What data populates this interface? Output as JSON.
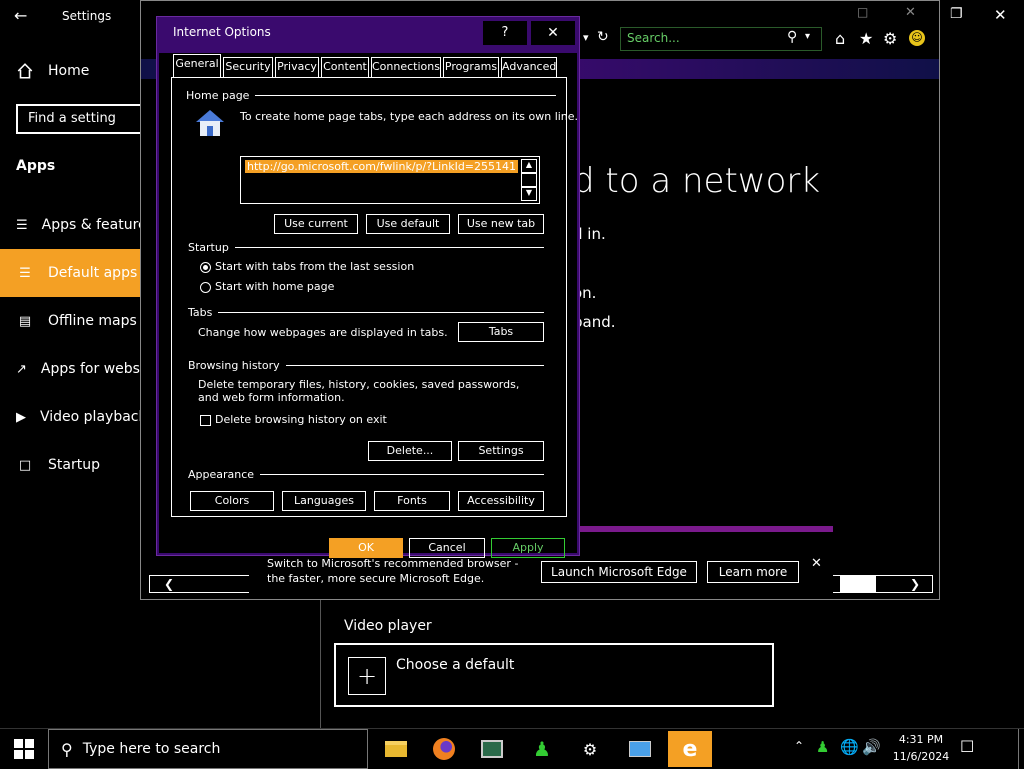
{
  "settings": {
    "title": "Settings",
    "home": "Home",
    "search_placeholder": "Find a setting",
    "section": "Apps",
    "nav": [
      "Apps & features",
      "Default apps",
      "Offline maps",
      "Apps for websites",
      "Video playback",
      "Startup"
    ],
    "video_player_title": "Video player",
    "choose_default": "Choose a default"
  },
  "browser": {
    "search_placeholder": "Search...",
    "heading_partial": "d to a network",
    "line1": "d in.",
    "line2": "on.",
    "line3": "band.",
    "notification": "Switch to Microsoft's recommended browser - the faster, more secure Microsoft Edge.",
    "launch_edge": "Launch Microsoft Edge",
    "learn_more": "Learn more"
  },
  "dialog": {
    "title": "Internet Options",
    "help": "?",
    "tabs": [
      "General",
      "Security",
      "Privacy",
      "Content",
      "Connections",
      "Programs",
      "Advanced"
    ],
    "home_page": {
      "label": "Home page",
      "hint": "To create home page tabs, type each address on its own line.",
      "url": "http://go.microsoft.com/fwlink/p/?LinkId=255141",
      "use_current": "Use current",
      "use_default": "Use default",
      "use_new_tab": "Use new tab"
    },
    "startup": {
      "label": "Startup",
      "opt1": "Start with tabs from the last session",
      "opt2": "Start with home page"
    },
    "tabs_section": {
      "label": "Tabs",
      "desc": "Change how webpages are displayed in tabs.",
      "button": "Tabs"
    },
    "history": {
      "label": "Browsing history",
      "desc": "Delete temporary files, history, cookies, saved passwords, and web form information.",
      "checkbox": "Delete browsing history on exit",
      "delete": "Delete...",
      "settings": "Settings"
    },
    "appearance": {
      "label": "Appearance",
      "colors": "Colors",
      "languages": "Languages",
      "fonts": "Fonts",
      "accessibility": "Accessibility"
    },
    "ok": "OK",
    "cancel": "Cancel",
    "apply": "Apply"
  },
  "taskbar": {
    "search_placeholder": "Type here to search",
    "time": "4:31 PM",
    "date": "11/6/2024"
  }
}
